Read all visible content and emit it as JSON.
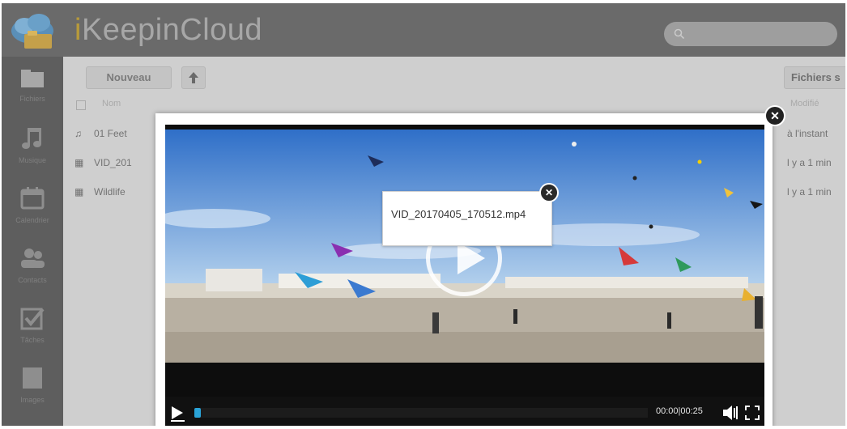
{
  "app": {
    "title_first": "i",
    "title_rest": "KeepinCloud",
    "title_first_color": "#b79a3a"
  },
  "search": {
    "icon": "search-icon"
  },
  "sidebar": {
    "items": [
      {
        "label": "Fichiers",
        "icon": "folder-icon"
      },
      {
        "label": "Musique",
        "icon": "music-icon"
      },
      {
        "label": "Calendrier",
        "icon": "calendar-icon"
      },
      {
        "label": "Contacts",
        "icon": "contacts-icon"
      },
      {
        "label": "Tâches",
        "icon": "checkbox-icon"
      },
      {
        "label": "Images",
        "icon": "image-icon"
      }
    ]
  },
  "toolbar": {
    "new_label": "Nouveau",
    "upload_icon": "arrow-up-icon",
    "shared_label": "Fichiers s"
  },
  "file_table": {
    "headers": {
      "name": "Nom",
      "modified": "Modifié"
    },
    "rows": [
      {
        "name": "01 Feet",
        "icon": "music-file-icon",
        "modified": "à l'instant"
      },
      {
        "name": "VID_201",
        "icon": "video-file-icon",
        "modified": "l y a 1 min"
      },
      {
        "name": "Wildlife",
        "icon": "video-file-icon",
        "modified": "l y a 1 min"
      }
    ]
  },
  "video_player": {
    "filename": "VID_20170405_170512.mp4",
    "time": "00:00|00:25",
    "progress": 0,
    "accent_color": "#2aa3d8"
  }
}
